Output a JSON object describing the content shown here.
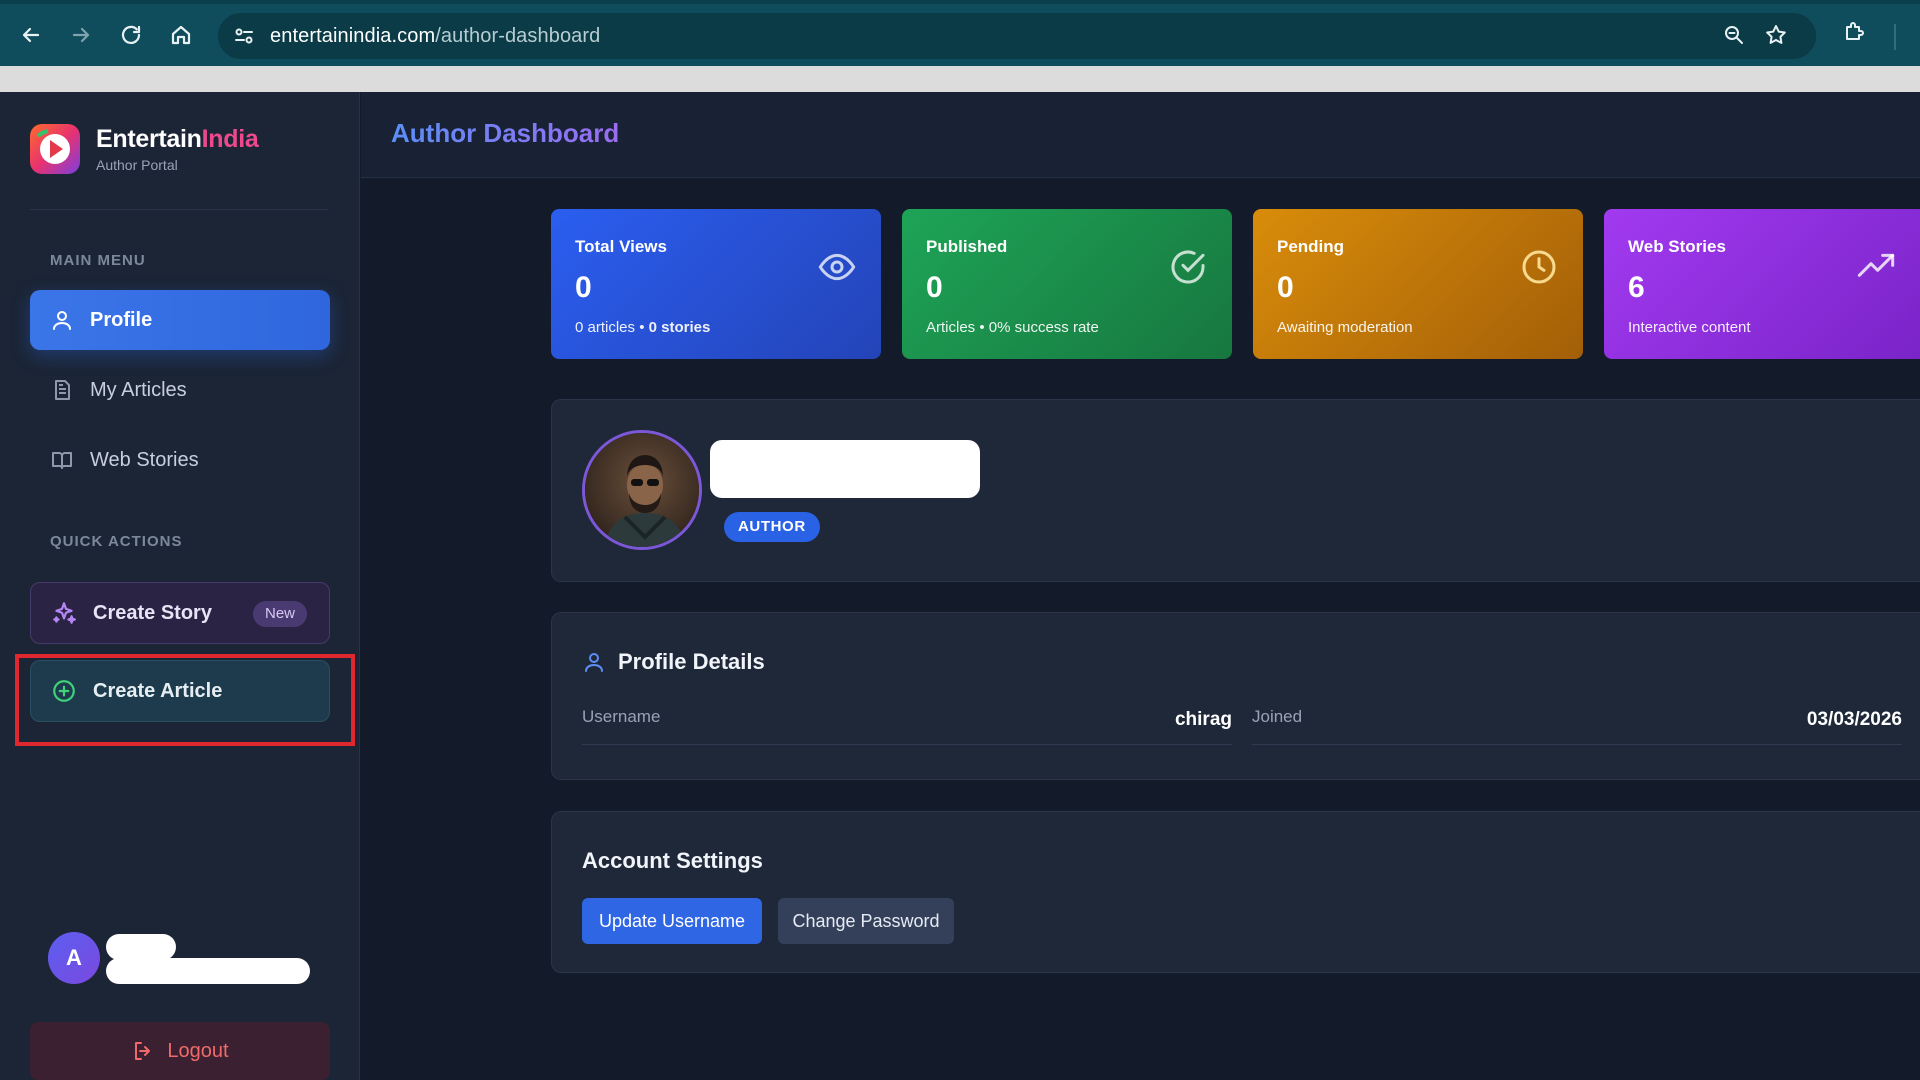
{
  "browser": {
    "url_domain": "entertainindia.com",
    "url_path": "/author-dashboard"
  },
  "brand": {
    "name_primary": "Entertain",
    "name_accent": "India",
    "subtitle": "Author Portal"
  },
  "sidebar": {
    "main_menu_label": "MAIN MENU",
    "items": [
      {
        "label": "Profile",
        "icon": "user-icon",
        "active": true
      },
      {
        "label": "My Articles",
        "icon": "document-icon",
        "active": false
      },
      {
        "label": "Web Stories",
        "icon": "book-icon",
        "active": false
      }
    ],
    "quick_actions_label": "QUICK ACTIONS",
    "create_story": {
      "label": "Create Story",
      "badge": "New",
      "icon": "sparkles-icon"
    },
    "create_article": {
      "label": "Create Article",
      "icon": "plus-circle-icon"
    },
    "user_initial": "A",
    "logout_label": "Logout"
  },
  "header": {
    "title": "Author Dashboard"
  },
  "stats": [
    {
      "label": "Total Views",
      "value": "0",
      "sub_prefix": "0 articles • ",
      "sub_bold": "0 stories",
      "icon": "eye-icon",
      "color": "#2b5ef0"
    },
    {
      "label": "Published",
      "value": "0",
      "sub": "Articles • 0% success rate",
      "icon": "check-circle-icon",
      "color": "#1ea457"
    },
    {
      "label": "Pending",
      "value": "0",
      "sub": "Awaiting moderation",
      "icon": "clock-icon",
      "color": "#d98c0a"
    },
    {
      "label": "Web Stories",
      "value": "6",
      "sub": "Interactive content",
      "icon": "trending-up-icon",
      "color": "#a23af0"
    }
  ],
  "profile": {
    "role": "AUTHOR"
  },
  "details": {
    "title": "Profile Details",
    "username_label": "Username",
    "username_value": "chirag",
    "joined_label": "Joined",
    "joined_value": "03/03/2026"
  },
  "account": {
    "title": "Account Settings",
    "update_username": "Update Username",
    "change_password": "Change Password"
  }
}
